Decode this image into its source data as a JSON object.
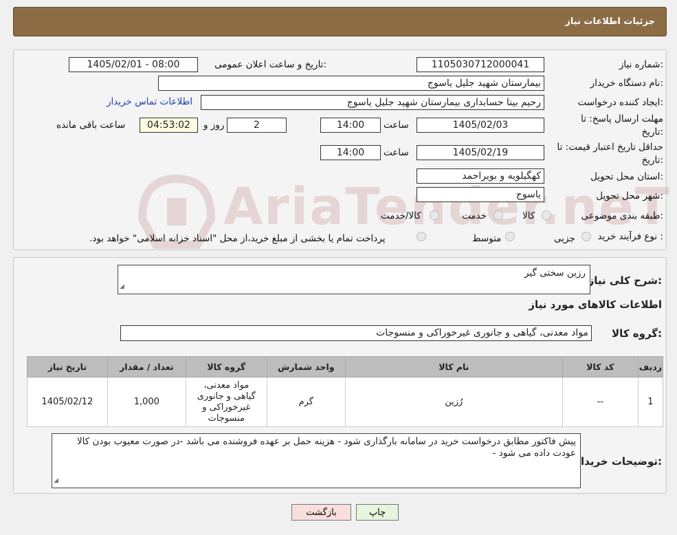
{
  "header": {
    "title": "جزئیات اطلاعات نیاز"
  },
  "info": {
    "need_number_label": "شماره نیاز:",
    "need_number": "1105030712000041",
    "announce_label": "تاریخ و ساعت اعلان عمومی:",
    "announce_value": "1405/02/01 - 08:00",
    "buyer_org_label": "نام دستگاه خریدار:",
    "buyer_org": "بیمارستان شهید جلیل یاسوج",
    "requester_label": "ایجاد کننده درخواست:",
    "requester": "رحیم بینا حسابداری بیمارستان شهید جلیل یاسوج",
    "contact_link": "اطلاعات تماس خریدار",
    "deadline_label_1": "مهلت ارسال پاسخ: تا",
    "deadline_label_2": "تاریخ:",
    "deadline_date": "1405/02/03",
    "time_label": "ساعت",
    "deadline_time": "14:00",
    "days_value": "2",
    "days_label": "روز و",
    "remaining_time": "04:53:02",
    "remaining_label": "ساعت باقی مانده",
    "validity_label_1": "حداقل تاریخ اعتبار قیمت: تا",
    "validity_label_2": "تاریخ:",
    "validity_date": "1405/02/19",
    "validity_time": "14:00",
    "province_label": "استان محل تحویل:",
    "province": "کهگیلویه و بویراحمد",
    "city_label": "شهر محل تحویل:",
    "city": "یاسوج",
    "category_label": "طبقه بندی موضوعی:",
    "category_options": [
      "کالا",
      "خدمت",
      "کالا/خدمت"
    ],
    "process_label": "نوع فرآیند خرید :",
    "process_options": [
      "جزیی",
      "متوسط"
    ],
    "process_note": "پرداخت تمام یا بخشی از مبلغ خرید،از محل \"اسناد خزانه اسلامی\" خواهد بود."
  },
  "summary": {
    "desc_label": "شرح کلی نیاز:",
    "desc_value": "رزین سختی گیر",
    "goods_info_title": "اطلاعات کالاهای مورد نیاز",
    "group_label": "گروه کالا:",
    "group_value": "مواد معدنی، گیاهی و جانوری غیرخوراکی و منسوجات"
  },
  "table": {
    "headers": [
      "ردیف",
      "کد کالا",
      "نام کالا",
      "واحد شمارش",
      "گروه کالا",
      "تعداد / مقدار",
      "تاریخ نیاز"
    ],
    "rows": [
      [
        "1",
        "--",
        "رُزین",
        "گرم",
        "مواد معدنی، گیاهی و جانوری غیرخوراکی و منسوجات",
        "1,000",
        "1405/02/12"
      ]
    ]
  },
  "notes": {
    "label": "توضیحات خریدار:",
    "value": "پیش فاکتور مطابق درخواست خرید در سامانه بارگذاری شود - هزینه حمل بر عهده فروشنده می باشد -در صورت معیوب بودن کالا عودت داده می شود -"
  },
  "buttons": {
    "print": "چاپ",
    "back": "بازگشت"
  },
  "watermark": {
    "text": "AriaTender.neT"
  },
  "colors": {
    "header": "#8b6c45",
    "link": "#1f3fb5",
    "back_button": "#f9dede",
    "print_button": "#e6f5dd"
  }
}
